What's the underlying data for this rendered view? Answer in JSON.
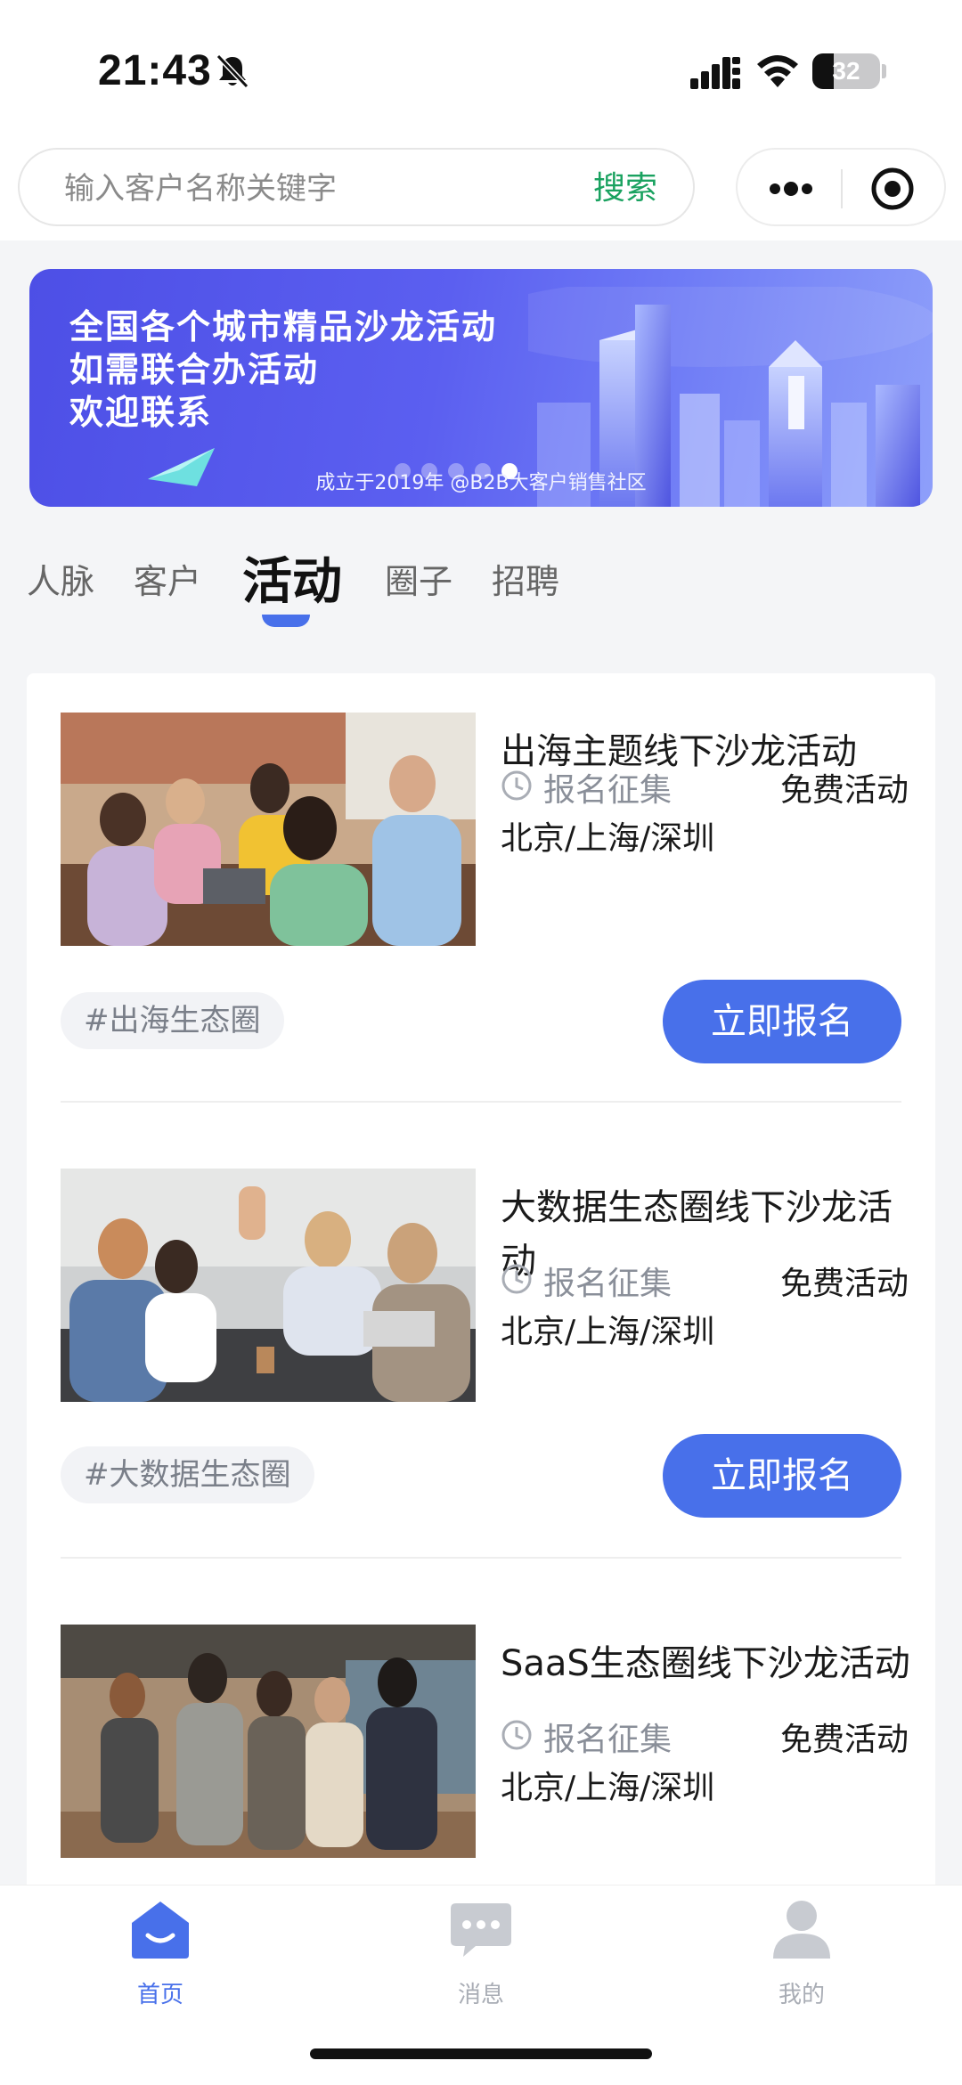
{
  "status_bar": {
    "time": "21:43",
    "battery": "32",
    "battery_level": 0.32,
    "icons": [
      "bell-slash-icon",
      "cellular-signal-icon",
      "wifi-icon",
      "battery-icon"
    ]
  },
  "search": {
    "placeholder": "输入客户名称关键字",
    "value": "",
    "button_label": "搜索"
  },
  "capsule": {
    "icons": [
      "more-dots-icon",
      "target-close-icon"
    ]
  },
  "banner": {
    "lines": [
      "全国各个城市精品沙龙活动",
      "如需联合办活动",
      "欢迎联系"
    ],
    "subtitle": "成立于2019年 @B2B大客户销售社区",
    "slide_count": 5,
    "active_slide": 4
  },
  "tabs": {
    "items": [
      {
        "label": "人脉"
      },
      {
        "label": "客户"
      },
      {
        "label": "活动"
      },
      {
        "label": "圈子"
      },
      {
        "label": "招聘"
      }
    ],
    "active_index": 2
  },
  "events": [
    {
      "title": "出海主题线下沙龙活动",
      "status": "报名征集",
      "fee": "免费活动",
      "cities": "北京/上海/深圳",
      "tag": "#出海生态圈",
      "button_label": "立即报名",
      "image": "team-meeting-photo"
    },
    {
      "title": "大数据生态圈线下沙龙活动",
      "status": "报名征集",
      "fee": "免费活动",
      "cities": "北京/上海/深圳",
      "tag": "#大数据生态圈",
      "button_label": "立即报名",
      "image": "high-five-photo"
    },
    {
      "title": "SaaS生态圈线下沙龙活动",
      "status": "报名征集",
      "fee": "免费活动",
      "cities": "北京/上海/深圳",
      "tag": "",
      "button_label": "",
      "image": "office-group-photo"
    }
  ],
  "bottom_nav": {
    "items": [
      {
        "label": "首页",
        "icon": "home-icon"
      },
      {
        "label": "消息",
        "icon": "message-icon"
      },
      {
        "label": "我的",
        "icon": "profile-icon"
      }
    ],
    "active_index": 0
  },
  "colors": {
    "accent": "#4870ea",
    "search_button": "#1aa260",
    "page_background": "#f4f5f7",
    "banner_start": "#4d4fe6",
    "banner_end": "#8e9ffa"
  }
}
